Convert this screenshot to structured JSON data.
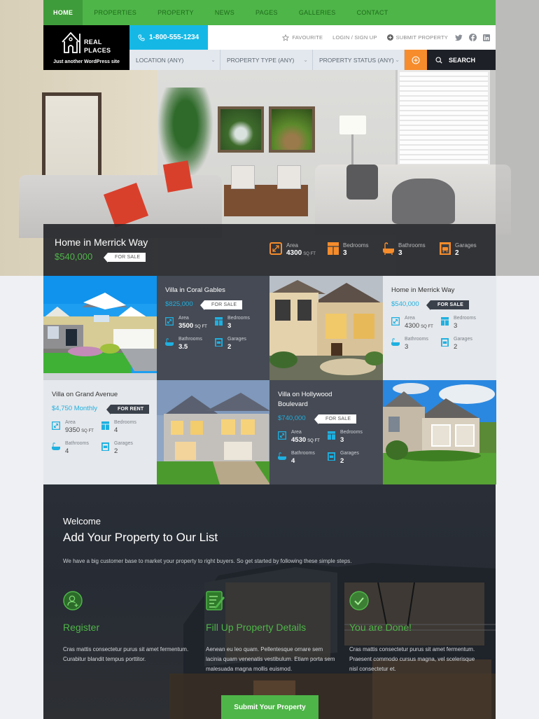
{
  "nav": {
    "items": [
      "Home",
      "Properties",
      "Property",
      "News",
      "Pages",
      "Galleries",
      "Contact"
    ],
    "active": "Home"
  },
  "logo": {
    "line1": "REAL",
    "line2": "PLACES",
    "tagline": "Just another WordPress site"
  },
  "header": {
    "phone": "1-800-555-1234",
    "favourite": "Favourite",
    "login": "Login / Sign up",
    "submit_property": "Submit Property",
    "social": [
      "twitter-icon",
      "facebook-icon",
      "linkedin-icon"
    ]
  },
  "search": {
    "location": "Location (Any)",
    "property_type": "Property Type (Any)",
    "property_status": "Property Status (Any)",
    "search_label": "Search"
  },
  "hero": {
    "title": "Home in Merrick Way",
    "price": "$540,000",
    "status": "For Sale",
    "area_label": "Area",
    "area_value": "4300",
    "area_unit": "SQ FT",
    "bedrooms_label": "Bedrooms",
    "bedrooms_value": "3",
    "bathrooms_label": "Bathrooms",
    "bathrooms_value": "3",
    "garages_label": "Garages",
    "garages_value": "2"
  },
  "labels": {
    "area": "Area",
    "bedrooms": "Bedrooms",
    "bathrooms": "Bathrooms",
    "garages": "Garages",
    "unit": "SQ FT"
  },
  "properties": [
    {
      "title": "Villa in Coral Gables",
      "price": "$825,000",
      "status": "For Sale",
      "area": "3500",
      "bedrooms": "3",
      "bathrooms": "3.5",
      "garages": "2"
    },
    {
      "title": "Home in Merrick Way",
      "price": "$540,000",
      "status": "For Sale",
      "area": "4300",
      "bedrooms": "3",
      "bathrooms": "3",
      "garages": "2"
    },
    {
      "title": "Villa on Grand Avenue",
      "price": "$4,750 Monthly",
      "status": "For Rent",
      "area": "9350",
      "bedrooms": "4",
      "bathrooms": "4",
      "garages": "2"
    },
    {
      "title": "Villa on Hollywood Boulevard",
      "price": "$740,000",
      "status": "For Sale",
      "area": "4530",
      "bedrooms": "3",
      "bathrooms": "4",
      "garages": "2"
    }
  ],
  "welcome": {
    "eyebrow": "Welcome",
    "title": "Add Your Property to Our List",
    "description": "We have a big customer base to market your property to right buyers. So get started by following these simple steps.",
    "steps": [
      {
        "title": "Register",
        "text": "Cras mattis consectetur purus sit amet fermentum. Curabitur blandit tempus porttitor.",
        "icon": "user-add-icon"
      },
      {
        "title": "Fill Up Property Details",
        "text": "Aenean eu leo quam. Pellentesque ornare sem lacinia quam venenatis vestibulum. Etiam porta sem malesuada magna mollis euismod.",
        "icon": "document-edit-icon"
      },
      {
        "title": "You are Done!",
        "text": "Cras mattis consectetur purus sit amet fermentum. Praesent commodo cursus magna, vel scelerisque nisl consectetur et.",
        "icon": "check-circle-icon"
      }
    ],
    "button": "Submit Your Property"
  },
  "colors": {
    "brand_green": "#4eb548",
    "accent_blue": "#15b8e5",
    "accent_orange": "#f68c2b",
    "dark_card": "#454a54",
    "light_card": "#e5e8ec"
  }
}
